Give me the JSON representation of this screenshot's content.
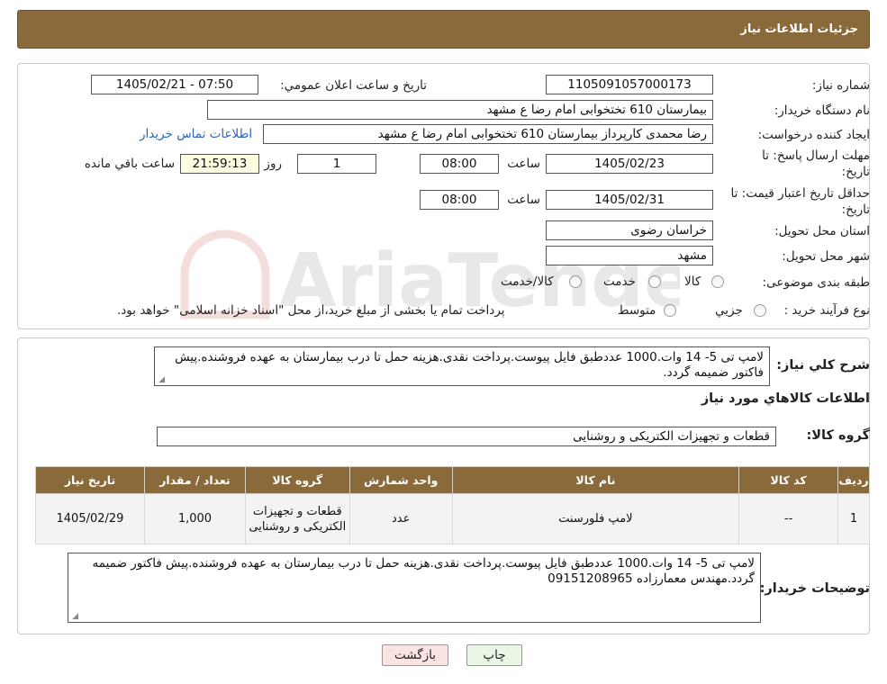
{
  "header": {
    "title": "جزئیات اطلاعات نیاز"
  },
  "form": {
    "need_number_label": "شماره نیاز:",
    "need_number": "1105091057000173",
    "announce_label": "تاریخ و ساعت اعلان عمومي:",
    "announce_value": "1405/02/21 - 07:50",
    "buyer_org_label": "نام دستگاه خریدار:",
    "buyer_org": "بیمارستان 610 تختخوابی امام رضا ع  مشهد",
    "creator_label": "ایجاد کننده درخواست:",
    "creator": "رضا محمدی کارپرداز بیمارستان 610 تختخوابی امام رضا ع  مشهد",
    "contact_link": "اطلاعات تماس خریدار",
    "deadline_label_1": "مهلت ارسال پاسخ: تا",
    "deadline_label_2": "تاریخ:",
    "deadline_date": "1405/02/23",
    "time_label": "ساعت",
    "deadline_time": "08:00",
    "days_value": "1",
    "days_label": "روز و",
    "remaining_time": "21:59:13",
    "remaining_label": "ساعت باقي مانده",
    "validity_label_1": "حداقل تاریخ اعتبار قیمت: تا",
    "validity_label_2": "تاریخ:",
    "validity_date": "1405/02/31",
    "validity_time": "08:00",
    "province_label": "استان محل تحویل:",
    "province": "خراسان رضوی",
    "city_label": "شهر محل تحویل:",
    "city": "مشهد",
    "category_label": "طبقه بندی موضوعی:",
    "category_options": [
      "کالا",
      "خدمت",
      "کالا/خدمت"
    ],
    "process_label": "نوع فرآیند خرید :",
    "process_options": [
      "جزیي",
      "متوسط"
    ],
    "process_note": "پرداخت تمام یا بخشی از مبلغ خرید،از محل \"اسناد خزانه اسلامی\" خواهد بود."
  },
  "description": {
    "label": "شرح کلي نیاز:",
    "text": "لامپ تی 5- 14 وات.1000 عددطبق فایل پیوست.پرداخت نقدی.هزینه حمل تا درب بیمارستان به عهده فروشنده.پیش فاکتور ضمیمه گردد."
  },
  "goods_info": {
    "title": "اطلاعات کالاهاي مورد نیاز",
    "group_label": "گروه کالا:",
    "group_value": "قطعات و تجهیزات الکتریکی و روشنایی"
  },
  "table": {
    "headers": [
      "ردیف",
      "کد کالا",
      "نام کالا",
      "واحد شمارش",
      "گروه کالا",
      "تعداد / مقدار",
      "تاریخ نیاز"
    ],
    "rows": [
      [
        "1",
        "--",
        "لامپ فلورسنت",
        "عدد",
        "قطعات و تجهیزات الکتریکی و روشنایی",
        "1,000",
        "1405/02/29"
      ]
    ]
  },
  "buyer_notes": {
    "label": "توضیحات خریدار:",
    "text": "لامپ تی 5- 14 وات.1000 عددطبق فایل پیوست.پرداخت نقدی.هزینه حمل تا درب بیمارستان به عهده فروشنده.پیش فاکتور ضمیمه گردد.مهندس معمارزاده 09151208965"
  },
  "buttons": {
    "print": "چاپ",
    "back": "بازگشت"
  },
  "watermark": {
    "text": "AriaTender.neT"
  },
  "colors": {
    "header": "#8a6a3b",
    "link": "#2a64c5",
    "print_bg": "#eaf6e6",
    "back_bg": "#fbe3e3",
    "time_bg": "#fdfbe0"
  }
}
